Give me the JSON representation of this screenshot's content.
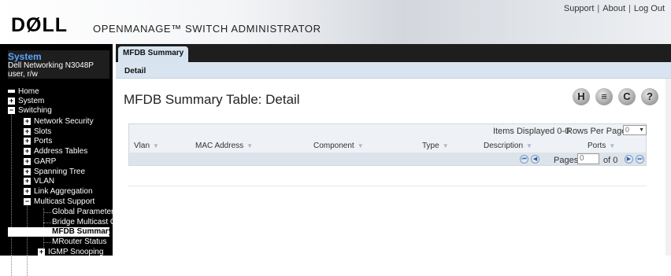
{
  "header": {
    "logo": "DØLL",
    "product_title": "OPENMANAGE™ SWITCH ADMINISTRATOR",
    "links": [
      "Support",
      "About",
      "Log Out"
    ],
    "separator": "|"
  },
  "system_box": {
    "title": "System",
    "model": "Dell Networking N3048P",
    "user": "user, r/w"
  },
  "nav_tree": [
    {
      "label": "Home",
      "expander": "",
      "icon": "home-icon"
    },
    {
      "label": "System",
      "expander": "+"
    },
    {
      "label": "Switching",
      "expander": "−"
    },
    {
      "label": "Network Security",
      "expander": "+"
    },
    {
      "label": "Slots",
      "expander": "+"
    },
    {
      "label": "Ports",
      "expander": "+"
    },
    {
      "label": "Address Tables",
      "expander": "+"
    },
    {
      "label": "GARP",
      "expander": "+"
    },
    {
      "label": "Spanning Tree",
      "expander": "+"
    },
    {
      "label": "VLAN",
      "expander": "+"
    },
    {
      "label": "Link Aggregation",
      "expander": "+"
    },
    {
      "label": "Multicast Support",
      "expander": "−"
    },
    {
      "label": "Global Parameters",
      "expander": ""
    },
    {
      "label": "Bridge Multicast Grc",
      "expander": ""
    },
    {
      "label": "MFDB Summary",
      "expander": "",
      "selected": true
    },
    {
      "label": "MRouter Status",
      "expander": ""
    },
    {
      "label": "IGMP Snooping",
      "expander": "+"
    }
  ],
  "tabs": {
    "main": "MFDB Summary",
    "sub": "Detail"
  },
  "page": {
    "title": "MFDB Summary Table: Detail",
    "toolbar_icons": [
      "save-icon",
      "print-icon",
      "refresh-icon",
      "help-icon"
    ],
    "toolbar_glyphs": [
      "H",
      "≡",
      "C",
      "?"
    ]
  },
  "table": {
    "items_displayed": "Items Displayed 0-0",
    "rows_per_page_label": "Rows Per Page",
    "rows_per_page_value": "0",
    "columns": [
      "Vlan",
      "MAC Address",
      "Component",
      "Type",
      "Description",
      "Ports"
    ],
    "rows": [],
    "pages_label": "Pages",
    "current_page": "0",
    "of_label": "of 0"
  },
  "colors": {
    "nav_background": "#000000",
    "system_title": "#59a4ff",
    "tab_bar": "#1e1e1e",
    "subbar": "#d8e5f1"
  }
}
